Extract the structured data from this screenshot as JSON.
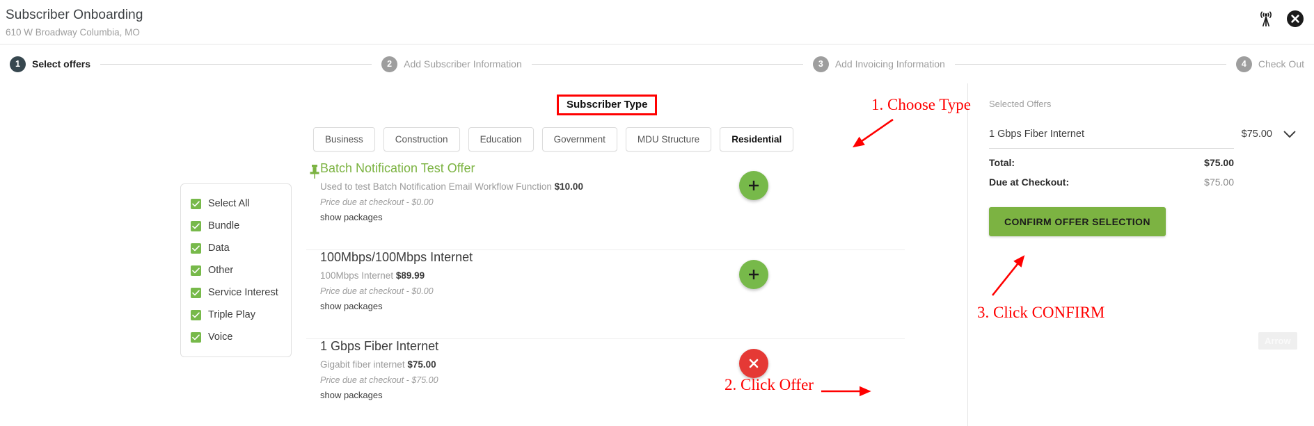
{
  "header": {
    "title": "Subscriber Onboarding",
    "subtitle": "610 W Broadway Columbia, MO",
    "icons": {
      "broadcast": "broadcast-tower-icon",
      "close": "close-circle-icon"
    }
  },
  "stepper": {
    "steps": [
      {
        "num": "1",
        "label": "Select offers",
        "state": "active"
      },
      {
        "num": "2",
        "label": "Add Subscriber Information",
        "state": "inactive"
      },
      {
        "num": "3",
        "label": "Add Invoicing Information",
        "state": "inactive"
      },
      {
        "num": "4",
        "label": "Check Out",
        "state": "inactive"
      }
    ]
  },
  "filters": {
    "items": [
      {
        "label": "Select All",
        "checked": true
      },
      {
        "label": "Bundle",
        "checked": true
      },
      {
        "label": "Data",
        "checked": true
      },
      {
        "label": "Other",
        "checked": true
      },
      {
        "label": "Service Interest",
        "checked": true
      },
      {
        "label": "Triple Play",
        "checked": true
      },
      {
        "label": "Voice",
        "checked": true
      }
    ]
  },
  "subscriber_type": {
    "heading": "Subscriber Type",
    "tabs": [
      {
        "label": "Business",
        "selected": false
      },
      {
        "label": "Construction",
        "selected": false
      },
      {
        "label": "Education",
        "selected": false
      },
      {
        "label": "Government",
        "selected": false
      },
      {
        "label": "MDU Structure",
        "selected": false
      },
      {
        "label": "Residential",
        "selected": true
      }
    ]
  },
  "offers": [
    {
      "name": "Batch Notification Test Offer",
      "featured": true,
      "pinned": true,
      "desc_text": "Used to test Batch Notification Email Workflow Function",
      "desc_price": "$10.00",
      "due": "Price due at checkout - $0.00",
      "packages_link": "show packages",
      "action": "add"
    },
    {
      "name": "100Mbps/100Mbps Internet",
      "featured": false,
      "pinned": false,
      "desc_text": "100Mbps Internet",
      "desc_price": "$89.99",
      "due": "Price due at checkout - $0.00",
      "packages_link": "show packages",
      "action": "add"
    },
    {
      "name": "1 Gbps Fiber Internet",
      "featured": false,
      "pinned": false,
      "desc_text": "Gigabit fiber internet",
      "desc_price": "$75.00",
      "due": "Price due at checkout - $75.00",
      "packages_link": "show packages",
      "action": "remove"
    }
  ],
  "summary": {
    "title": "Selected Offers",
    "selected": [
      {
        "name": "1 Gbps Fiber Internet",
        "price": "$75.00"
      }
    ],
    "total_label": "Total:",
    "total_value": "$75.00",
    "due_label": "Due at Checkout:",
    "due_value": "$75.00",
    "confirm_label": "CONFIRM OFFER SELECTION",
    "watermark": "Arrow"
  },
  "annotations": [
    {
      "id": "anno-1",
      "text": "1. Choose Type"
    },
    {
      "id": "anno-2",
      "text": "2. Click Offer"
    },
    {
      "id": "anno-3",
      "text": "3. Click CONFIRM"
    }
  ],
  "colors": {
    "green": "#7cb342",
    "green_check": "#77b94a",
    "red": "#e53935",
    "annotation_red": "#ff0000",
    "step_active": "#37474f",
    "step_inactive": "#9e9e9e"
  }
}
